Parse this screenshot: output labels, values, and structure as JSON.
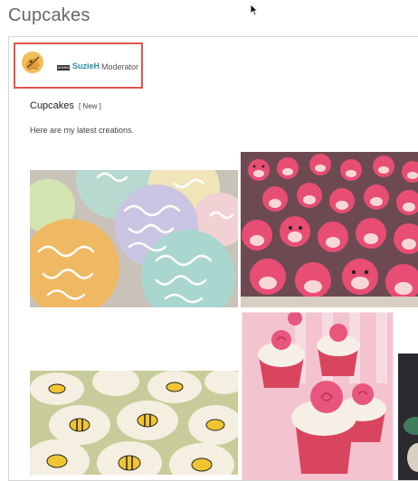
{
  "page": {
    "title": "Cupcakes"
  },
  "post": {
    "author": {
      "name": "SuzieH",
      "role": "Moderator",
      "badge": "ADMIN"
    },
    "title": "Cupcakes",
    "tag": "[ New ]",
    "body": "Here are my latest creations."
  },
  "gallery": {
    "images": [
      {
        "name": "swirl-frosting-cupcakes-photo"
      },
      {
        "name": "pig-cupcakes-photo"
      },
      {
        "name": "bee-cupcakes-photo"
      },
      {
        "name": "rose-cupcakes-photo"
      }
    ]
  },
  "colors": {
    "highlight": "#e0554a",
    "author_link": "#2a8ca8"
  }
}
